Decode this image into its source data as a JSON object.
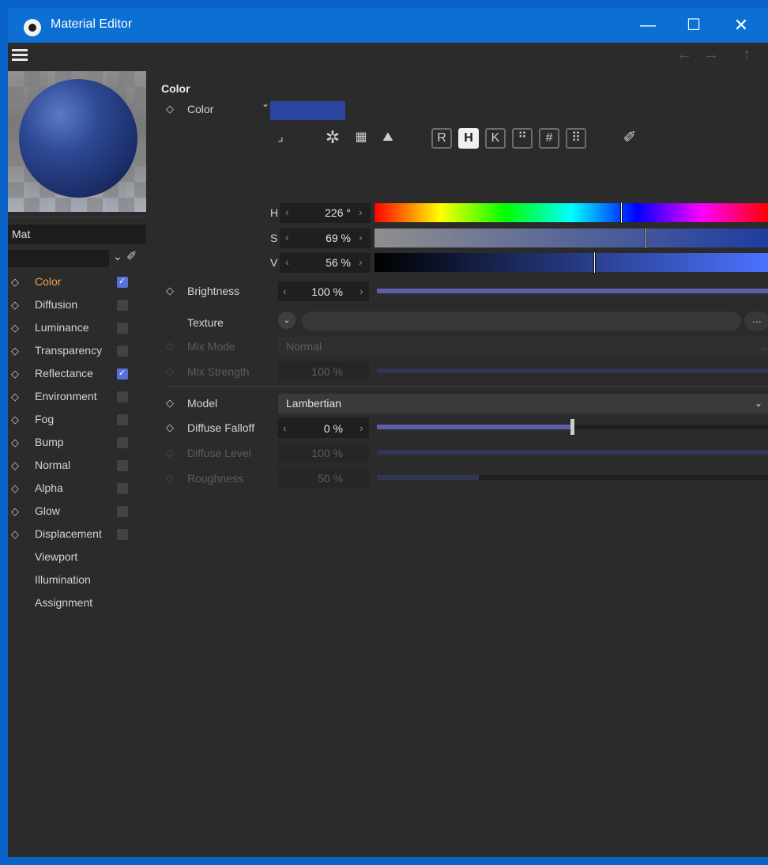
{
  "window": {
    "title": "Material Editor",
    "controls": {
      "minimize": "—",
      "maximize": "☐",
      "close": "✕"
    }
  },
  "nav": {
    "back": "←",
    "forward": "→",
    "up": "↑"
  },
  "material": {
    "name": "Mat"
  },
  "channels": [
    {
      "label": "Color",
      "checked": true,
      "active": true
    },
    {
      "label": "Diffusion",
      "checked": false
    },
    {
      "label": "Luminance",
      "checked": false
    },
    {
      "label": "Transparency",
      "checked": false
    },
    {
      "label": "Reflectance",
      "checked": true
    },
    {
      "label": "Environment",
      "checked": false
    },
    {
      "label": "Fog",
      "checked": false
    },
    {
      "label": "Bump",
      "checked": false
    },
    {
      "label": "Normal",
      "checked": false
    },
    {
      "label": "Alpha",
      "checked": false
    },
    {
      "label": "Glow",
      "checked": false
    },
    {
      "label": "Displacement",
      "checked": false
    },
    {
      "label": "Viewport"
    },
    {
      "label": "Illumination"
    },
    {
      "label": "Assignment"
    }
  ],
  "color_section": {
    "title": "Color",
    "color_label": "Color",
    "swatch_color": "#2a45a0",
    "mode_buttons": [
      "R",
      "H",
      "K",
      "#"
    ],
    "active_mode": "H",
    "hsv": {
      "h": {
        "label": "H",
        "value": "226 °",
        "fraction": 0.628
      },
      "s": {
        "label": "S",
        "value": "69 %",
        "fraction": 0.69
      },
      "v": {
        "label": "V",
        "value": "56 %",
        "fraction": 0.56
      }
    },
    "brightness": {
      "label": "Brightness",
      "value": "100 %",
      "fraction": 1.0
    },
    "texture": {
      "label": "Texture",
      "more": "..."
    },
    "mix_mode": {
      "label": "Mix Mode",
      "value": "Normal"
    },
    "mix_strength": {
      "label": "Mix Strength",
      "value": "100 %",
      "fraction": 1.0
    },
    "model": {
      "label": "Model",
      "value": "Lambertian"
    },
    "diffuse_falloff": {
      "label": "Diffuse Falloff",
      "value": "0 %",
      "fraction": 0.5
    },
    "diffuse_level": {
      "label": "Diffuse Level",
      "value": "100 %",
      "fraction": 1.0
    },
    "roughness": {
      "label": "Roughness",
      "value": "50 %",
      "fraction": 0.26
    }
  }
}
